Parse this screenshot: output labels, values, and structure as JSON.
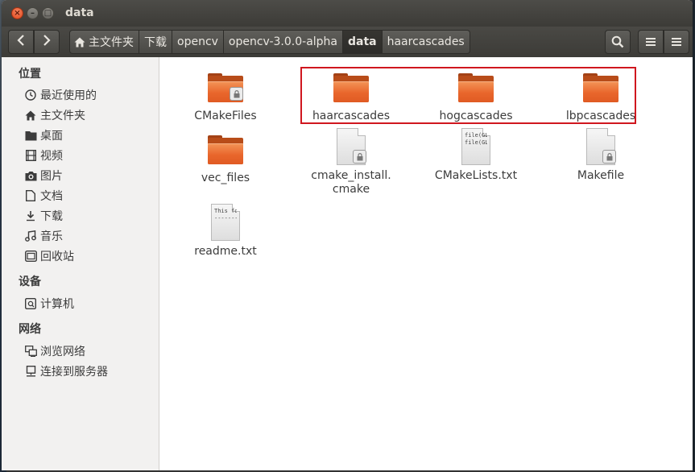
{
  "window": {
    "title": "data"
  },
  "breadcrumbs": [
    {
      "label": "主文件夹",
      "icon": "home-icon"
    },
    {
      "label": "下载"
    },
    {
      "label": "opencv"
    },
    {
      "label": "opencv-3.0.0-alpha"
    },
    {
      "label": "data",
      "active": true
    },
    {
      "label": "haarcascades"
    }
  ],
  "sidebar": {
    "places_header": "位置",
    "places": [
      {
        "label": "最近使用的",
        "icon": "clock-icon"
      },
      {
        "label": "主文件夹",
        "icon": "home-icon"
      },
      {
        "label": "桌面",
        "icon": "desktop-folder-icon"
      },
      {
        "label": "视频",
        "icon": "film-icon"
      },
      {
        "label": "图片",
        "icon": "camera-icon"
      },
      {
        "label": "文档",
        "icon": "document-icon"
      },
      {
        "label": "下载",
        "icon": "download-icon"
      },
      {
        "label": "音乐",
        "icon": "music-icon"
      },
      {
        "label": "回收站",
        "icon": "trash-icon"
      }
    ],
    "devices_header": "设备",
    "devices": [
      {
        "label": "计算机",
        "icon": "drive-icon"
      }
    ],
    "network_header": "网络",
    "network": [
      {
        "label": "浏览网络",
        "icon": "network-icon"
      },
      {
        "label": "连接到服务器",
        "icon": "server-icon"
      }
    ]
  },
  "files": [
    {
      "name": "CMakeFiles",
      "type": "folder",
      "locked": true
    },
    {
      "name": "haarcascades",
      "type": "folder"
    },
    {
      "name": "hogcascades",
      "type": "folder"
    },
    {
      "name": "lbpcascades",
      "type": "folder"
    },
    {
      "name": "vec_files",
      "type": "folder"
    },
    {
      "name": "cmake_install.\ncmake",
      "type": "file",
      "locked": true
    },
    {
      "name": "CMakeLists.txt",
      "type": "text",
      "preview": "file(GL\nfile(GL"
    },
    {
      "name": "Makefile",
      "type": "file",
      "locked": true
    },
    {
      "name": "readme.txt",
      "type": "text",
      "preview": "This fo\n--------"
    }
  ],
  "colors": {
    "folder_orange": "#e9662c",
    "highlight_red": "#d0171f"
  }
}
